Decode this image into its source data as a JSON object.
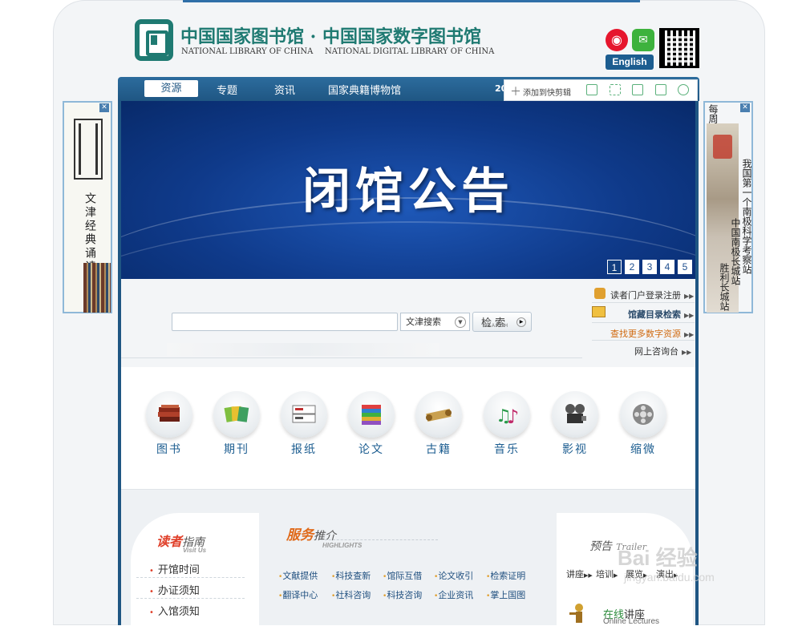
{
  "header": {
    "title": "中国国家图书馆 · 中国国家数字图书馆",
    "subtitle_left": "NATIONAL LIBRARY OF CHINA",
    "subtitle_right": "NATIONAL DIGITAL LIBRARY OF CHINA",
    "english_label": "English",
    "weibo_icon": "weibo-icon",
    "wechat_icon": "wechat-icon"
  },
  "nav": {
    "items": [
      "资源",
      "专题",
      "资讯",
      "国家典籍博物馆"
    ],
    "active": "资源",
    "year_fragment": "20"
  },
  "toolbox": {
    "add_label": "添加到快剪辑",
    "icons": [
      "clip-icon",
      "fullscreen-icon",
      "save-icon",
      "share-icon",
      "settings-icon"
    ]
  },
  "banner": {
    "title": "闭馆公告",
    "slides": [
      "1",
      "2",
      "3",
      "4",
      "5"
    ],
    "active_slide": "1"
  },
  "left_ad": {
    "text": "文津经典诵读"
  },
  "right_ad": {
    "header": "每周一库",
    "text": "我国第一个南极科学考察站",
    "photo_text": "中国南极长城站",
    "left_text": "胜利长城站"
  },
  "search": {
    "input_value": "",
    "select_value": "文津搜索",
    "button_label": "检索",
    "button_sub": "SEARCH"
  },
  "quick_links": [
    "读者门户登录注册",
    "馆藏目录检索",
    "查找更多数字资源",
    "网上咨询台"
  ],
  "resources": [
    "图书",
    "期刊",
    "报纸",
    "论文",
    "古籍",
    "音乐",
    "影视",
    "缩微"
  ],
  "reader_guide": {
    "title_red": "读者",
    "title_gray": "指南",
    "sub": "Visit Us",
    "items": [
      "开馆时间",
      "办证须知",
      "入馆须知"
    ]
  },
  "services": {
    "title_red": "服务",
    "title_gray": "推介",
    "sub": "HIGHLIGHTS",
    "row1": [
      "文献提供",
      "科技查新",
      "馆际互借",
      "论文收引",
      "检索证明"
    ],
    "row2": [
      "翻译中心",
      "社科咨询",
      "科技咨询",
      "企业资讯",
      "掌上国图"
    ]
  },
  "trailer": {
    "title": "预告",
    "sub": "Trailer",
    "items": [
      "讲座",
      "培训",
      "展览",
      "演出"
    ],
    "online_prefix": "在线",
    "online_title": "讲座",
    "online_sub": "Online Lectures"
  },
  "watermark": {
    "brand": "Bai 经验",
    "url": "jingyan.baidu.com"
  },
  "colors": {
    "brand_green": "#1f7a72",
    "nav_blue": "#1f5683",
    "banner_blue": "#0f3a8a",
    "accent_red": "#e0402a"
  }
}
